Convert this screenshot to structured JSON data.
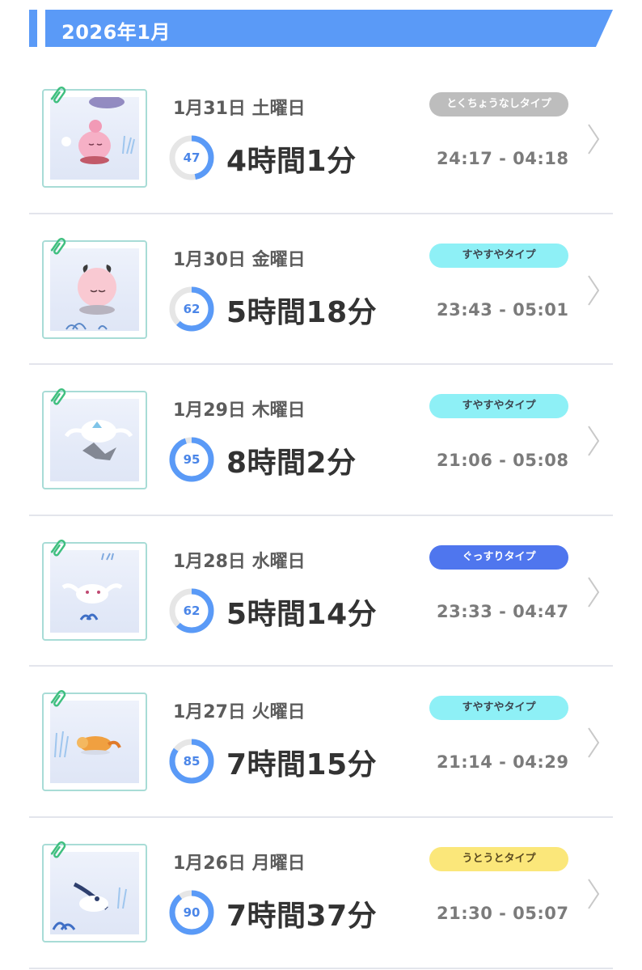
{
  "month": {
    "title": "2026年1月"
  },
  "colors": {
    "accent": "#5a9af7",
    "score_ring": "#5a9af7",
    "score_track": "#e6e6e6"
  },
  "records": [
    {
      "date": "1月31日 土曜日",
      "score": "47",
      "score_value": 47,
      "duration": "4時間1分",
      "type": "とくちょうなしタイプ",
      "type_style": "grey",
      "time_range": "24:17 - 04:18"
    },
    {
      "date": "1月30日 金曜日",
      "score": "62",
      "score_value": 62,
      "duration": "5時間18分",
      "type": "すやすやタイプ",
      "type_style": "cyan",
      "time_range": "23:43 - 05:01"
    },
    {
      "date": "1月29日 木曜日",
      "score": "95",
      "score_value": 95,
      "duration": "8時間2分",
      "type": "すやすやタイプ",
      "type_style": "cyan",
      "time_range": "21:06 - 05:08"
    },
    {
      "date": "1月28日 水曜日",
      "score": "62",
      "score_value": 62,
      "duration": "5時間14分",
      "type": "ぐっすりタイプ",
      "type_style": "blue",
      "time_range": "23:33 - 04:47"
    },
    {
      "date": "1月27日 火曜日",
      "score": "85",
      "score_value": 85,
      "duration": "7時間15分",
      "type": "すやすやタイプ",
      "type_style": "cyan",
      "time_range": "21:14 - 04:29"
    },
    {
      "date": "1月26日 月曜日",
      "score": "90",
      "score_value": 90,
      "duration": "7時間37分",
      "type": "うとうとタイプ",
      "type_style": "yellow",
      "time_range": "21:30 - 05:07"
    }
  ]
}
